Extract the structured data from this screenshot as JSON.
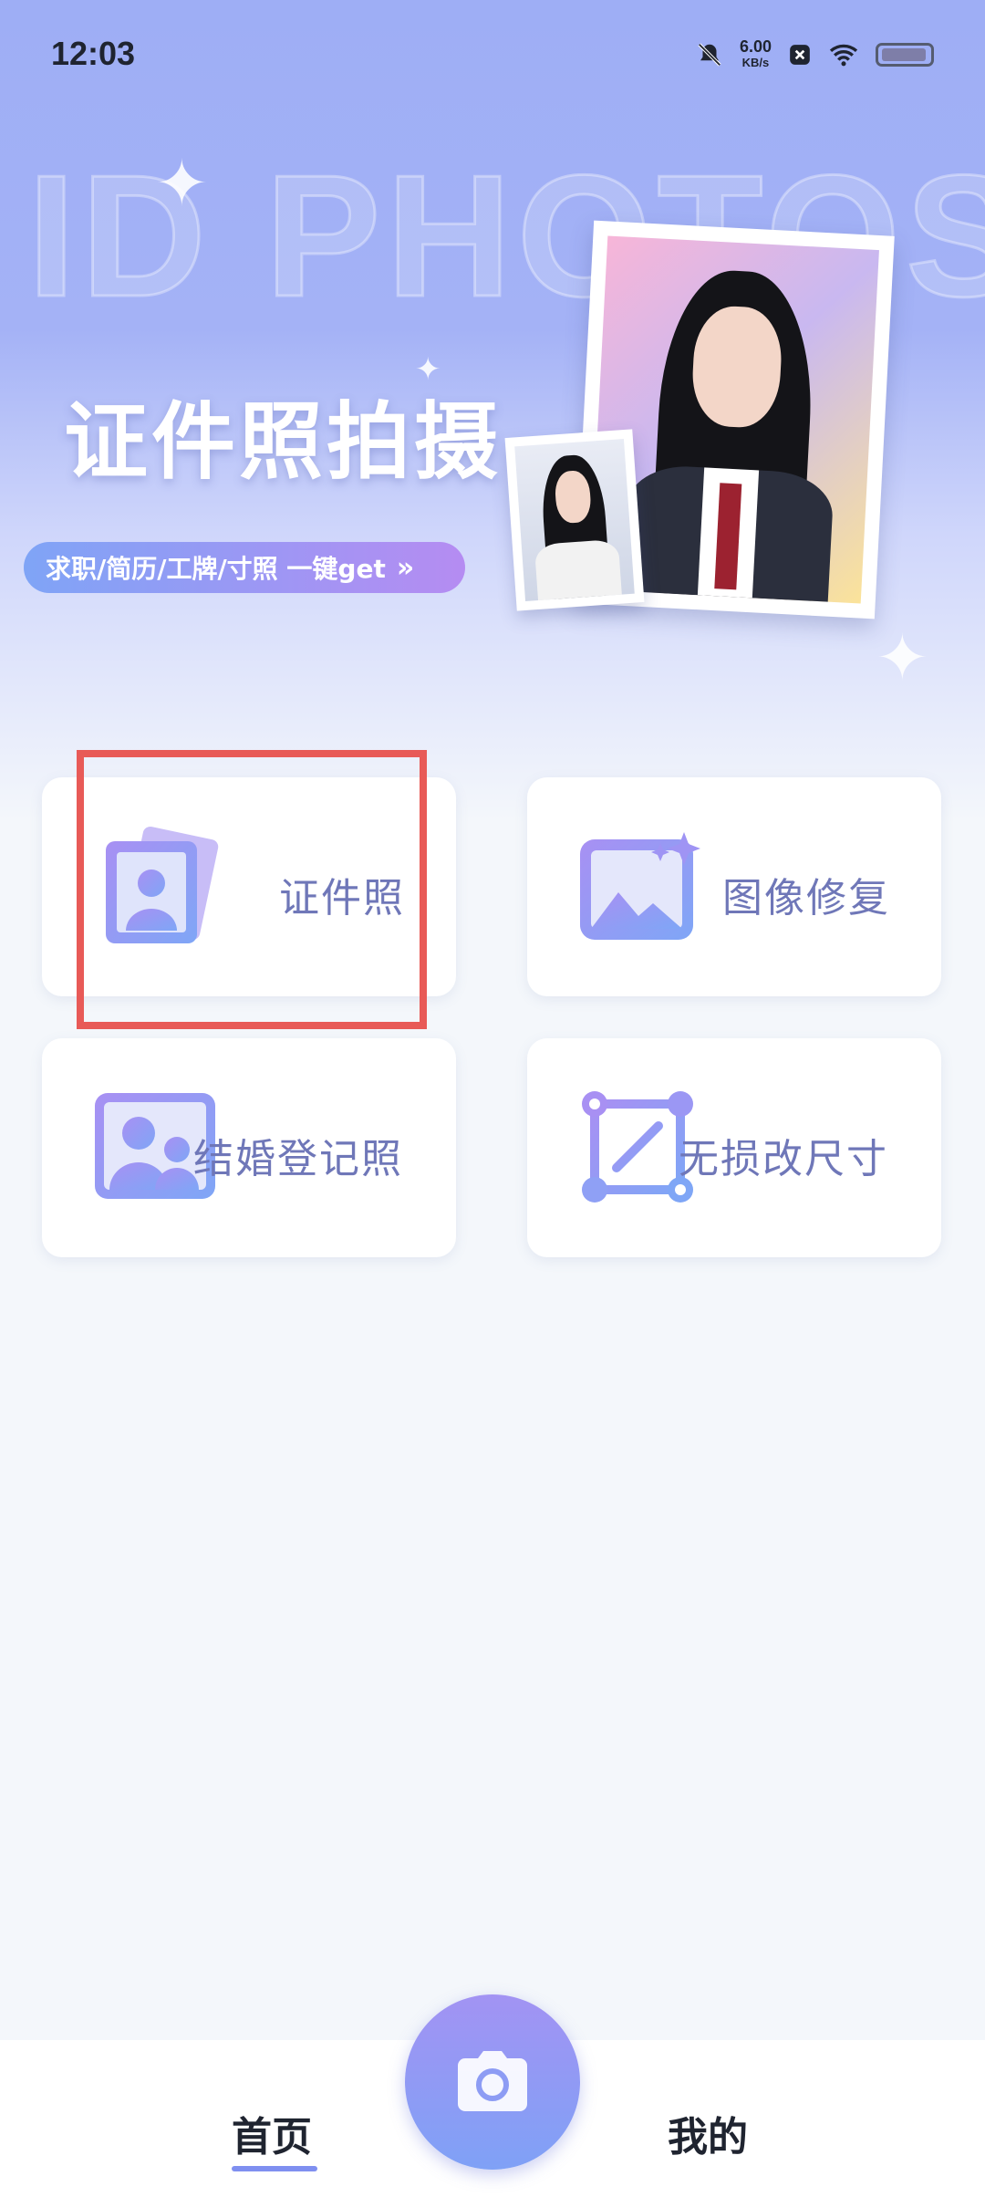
{
  "status_bar": {
    "time": "12:03",
    "speed_value": "6.00",
    "speed_unit": "KB/s",
    "icons": [
      "bell-muted-icon",
      "x-app-icon",
      "wifi-icon",
      "battery-icon"
    ]
  },
  "hero": {
    "background_text": "ID PHOTOS",
    "title": "证件照拍摄",
    "tagline": "求职/简历/工牌/寸照 一键get",
    "tagline_arrow": "»",
    "accent_gradient": [
      "#7fa4f6",
      "#b58cf2"
    ]
  },
  "features": {
    "id_photo": {
      "label": "证件照",
      "icon": "id-photo-icon"
    },
    "image_repair": {
      "label": "图像修复",
      "icon": "image-sparkle-icon"
    },
    "marriage_photo": {
      "label": "结婚登记照",
      "icon": "couple-photo-icon"
    },
    "resize": {
      "label": "无损改尺寸",
      "icon": "resize-icon"
    }
  },
  "bottom_nav": {
    "home": "首页",
    "mine": "我的",
    "camera_icon": "camera-icon",
    "active_color": "#7f8ff0"
  },
  "colors": {
    "hero_top": "#9eaef5",
    "card_text": "#6f77b8",
    "highlight": "#e85a57"
  }
}
